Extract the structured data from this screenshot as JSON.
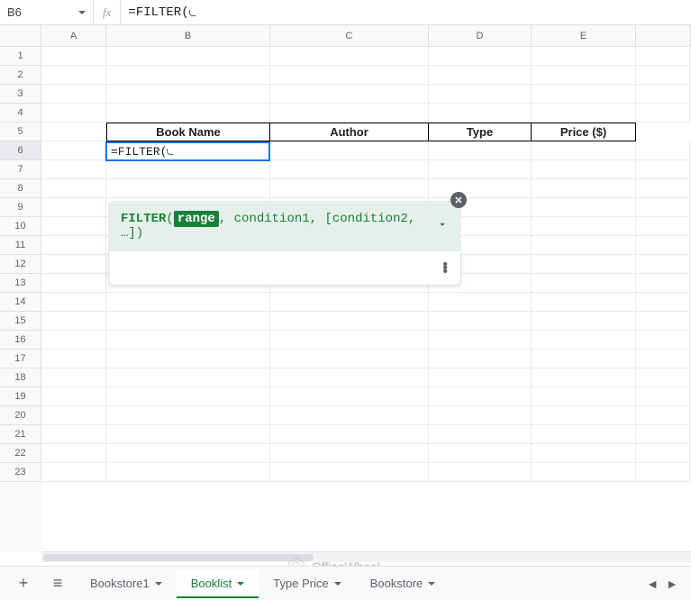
{
  "nameBox": "B6",
  "formulaBar": "=FILTER(",
  "columns": [
    "A",
    "B",
    "C",
    "D",
    "E"
  ],
  "visibleRowCount": 23,
  "selectedRow": 6,
  "tableHeaders": {
    "b": "Book Name",
    "c": "Author",
    "d": "Type",
    "e": "Price ($)"
  },
  "activeCell": {
    "text": "=FILTER(",
    "row": 6,
    "col": "B"
  },
  "tooltip": {
    "fn": "FILTER",
    "rangeArg": "range",
    "restArgs": ", condition1, [condition2, …])"
  },
  "sheetTabs": [
    {
      "label": "Bookstore1",
      "active": false
    },
    {
      "label": "Booklist",
      "active": true
    },
    {
      "label": "Type Price",
      "active": false
    },
    {
      "label": "Bookstore",
      "active": false
    }
  ],
  "watermark": "OfficeWheel"
}
